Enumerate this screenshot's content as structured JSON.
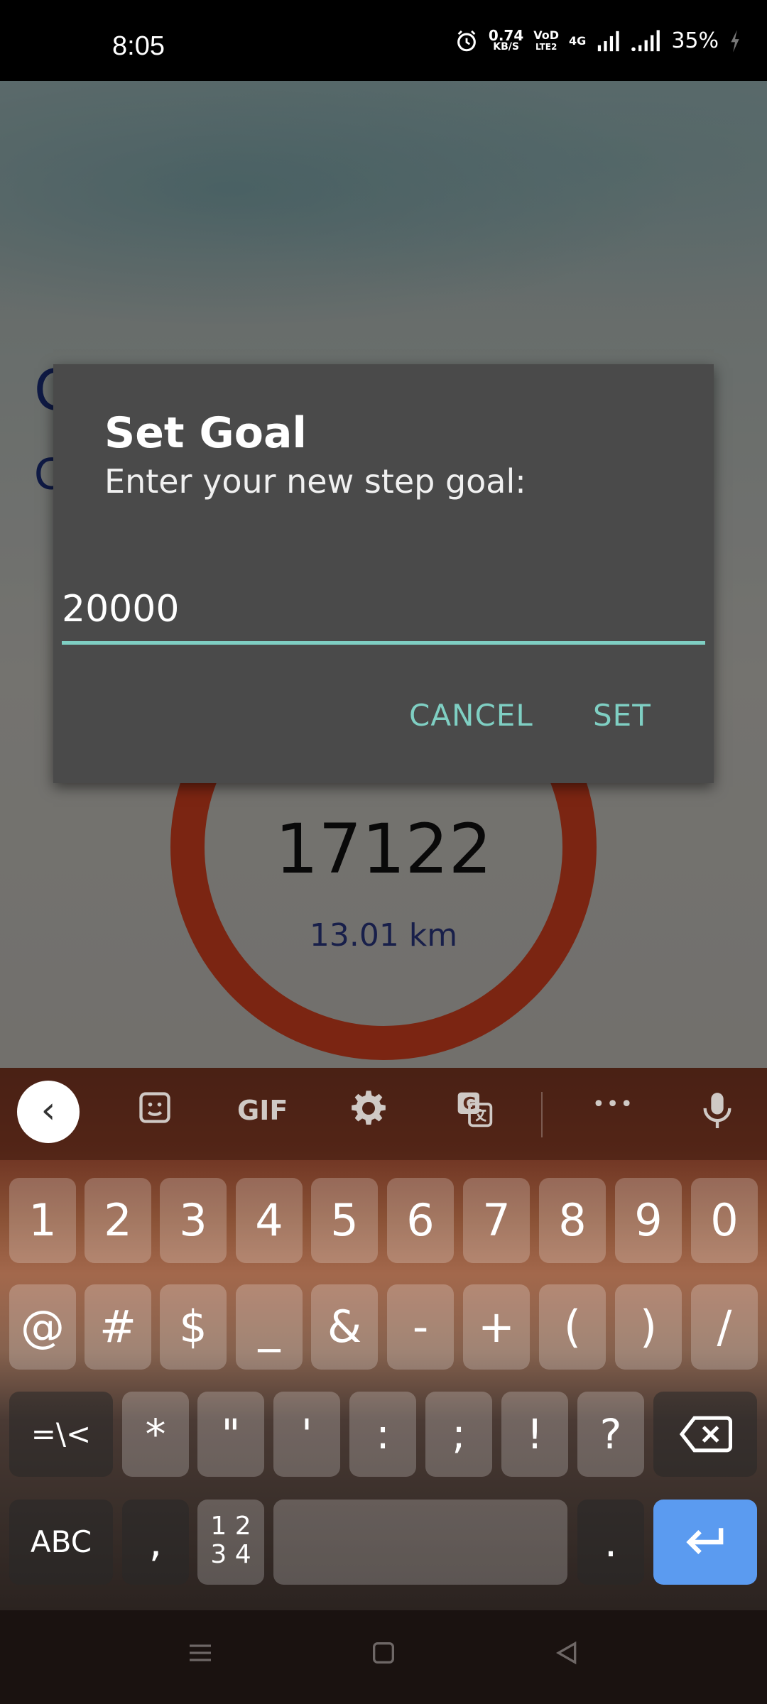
{
  "status_bar": {
    "time": "8:05",
    "speed_value": "0.74",
    "speed_unit": "KB/S",
    "volte": "VoD",
    "lte": "LTE2",
    "net": "4G",
    "battery": "35%"
  },
  "background_app": {
    "steps": "17122",
    "distance": "13.01 km",
    "heading_letter_1": "C",
    "heading_letter_2": "C",
    "ring_color": "#d4401f"
  },
  "dialog": {
    "title": "Set Goal",
    "message": "Enter your new step goal:",
    "input_value": "20000",
    "cancel_label": "CANCEL",
    "set_label": "SET",
    "accent_color": "#7fcfc3"
  },
  "keyboard": {
    "toolbar": {
      "back": "‹",
      "gif": "GIF",
      "more": "•••"
    },
    "row1": [
      "1",
      "2",
      "3",
      "4",
      "5",
      "6",
      "7",
      "8",
      "9",
      "0"
    ],
    "row2": [
      "@",
      "#",
      "$",
      "_",
      "&",
      "-",
      "+",
      "(",
      ")",
      "/"
    ],
    "row3": [
      "=\\<",
      "*",
      "\"",
      "'",
      ":",
      ";",
      "!",
      "?"
    ],
    "row4": {
      "abc": "ABC",
      "comma": ",",
      "numpad_top": "1 2",
      "numpad_bottom": "3 4",
      "period": "."
    }
  }
}
